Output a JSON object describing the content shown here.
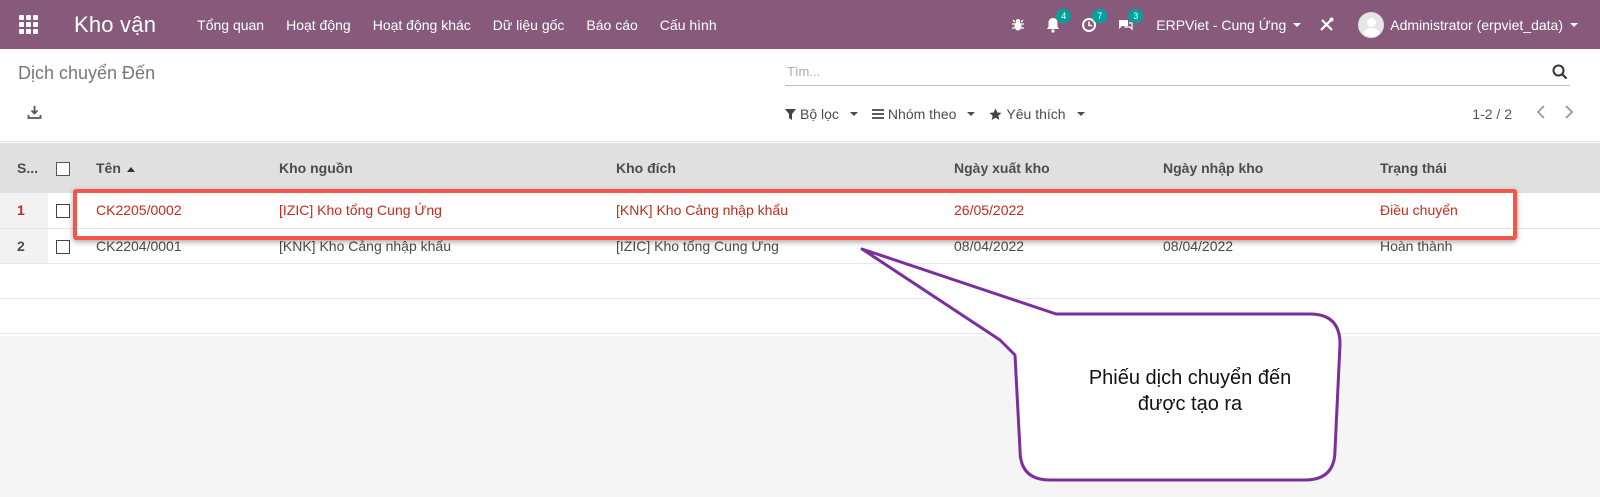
{
  "topbar": {
    "app_name": "Kho vận",
    "menu": [
      "Tổng quan",
      "Hoạt động",
      "Hoạt động khác",
      "Dữ liệu gốc",
      "Báo cáo",
      "Cấu hình"
    ],
    "notifications": {
      "bell": "4",
      "activity": "7",
      "messages": "3"
    },
    "company": "ERPViet - Cung Ứng",
    "user": "Administrator (erpviet_data)",
    "accent": "#875a7b"
  },
  "control": {
    "title": "Dịch chuyển Đến",
    "search_placeholder": "Tìm...",
    "filters": {
      "filter": "Bộ lọc",
      "group_by": "Nhóm theo",
      "favorites": "Yêu thích"
    },
    "pager": "1-2 / 2"
  },
  "table": {
    "headers": {
      "seq": "S...",
      "name": "Tên",
      "source": "Kho nguồn",
      "dest": "Kho đích",
      "date_out": "Ngày xuất kho",
      "date_in": "Ngày nhập kho",
      "state": "Trạng thái"
    },
    "rows": [
      {
        "seq": "1",
        "name": "CK2205/0002",
        "source": "[IZIC] Kho tổng Cung Ứng",
        "dest": "[KNK] Kho Cảng nhập khẩu",
        "date_out": "26/05/2022",
        "date_in": "",
        "state": "Điều chuyển"
      },
      {
        "seq": "2",
        "name": "CK2204/0001",
        "source": "[KNK] Kho Cảng nhập khẩu",
        "dest": "[IZIC] Kho tổng Cung Ứng",
        "date_out": "08/04/2022",
        "date_in": "08/04/2022",
        "state": "Hoàn thành"
      }
    ]
  },
  "annotation": {
    "line1": "Phiếu dịch chuyển đến",
    "line2": "được tạo ra",
    "highlight_color": "#f2574a",
    "callout_color": "#7b2f9e"
  }
}
